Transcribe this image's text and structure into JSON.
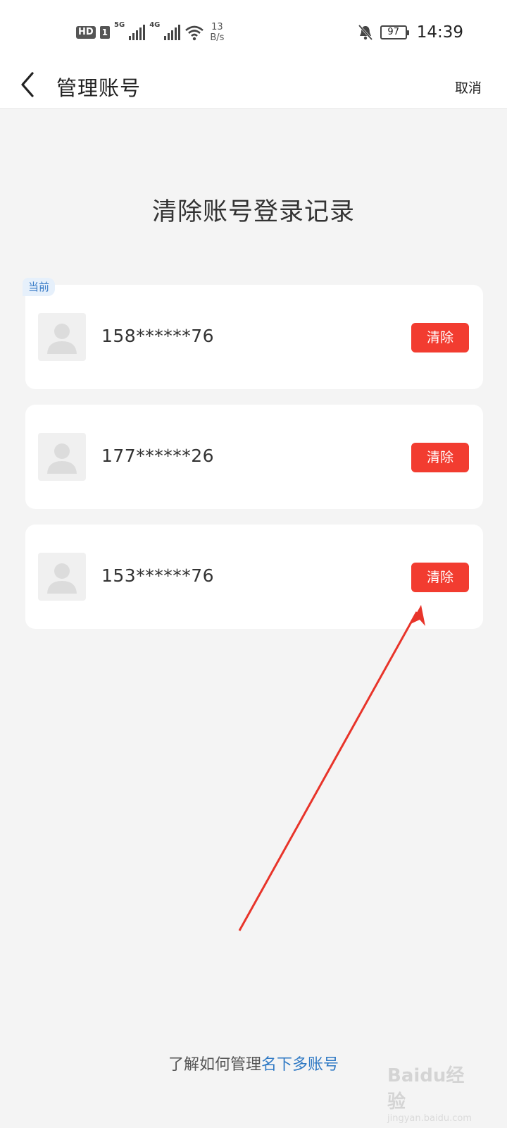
{
  "status_bar": {
    "hd_label": "HD",
    "sim_label": "1",
    "net1": "5G",
    "net2": "4G",
    "speed_value": "13",
    "speed_unit": "B/s",
    "battery": "97",
    "time": "14:39"
  },
  "nav": {
    "title": "管理账号",
    "cancel_label": "取消"
  },
  "heading": "清除账号登录记录",
  "accounts": [
    {
      "tag": "当前",
      "number": "158******76",
      "clear_label": "清除"
    },
    {
      "number": "177******26",
      "clear_label": "清除"
    },
    {
      "number": "153******76",
      "clear_label": "清除"
    }
  ],
  "footer": {
    "prefix": "了解如何管理",
    "link": "名下多账号"
  },
  "watermark": {
    "logo": "Baidu经验",
    "sub": "jingyan.baidu.com"
  },
  "colors": {
    "clear_button": "#f23c30",
    "link": "#2f79c4",
    "current_tag_bg": "#e6f0fb",
    "current_tag_text": "#3a7cc7",
    "annotation_arrow": "#e8342a"
  }
}
